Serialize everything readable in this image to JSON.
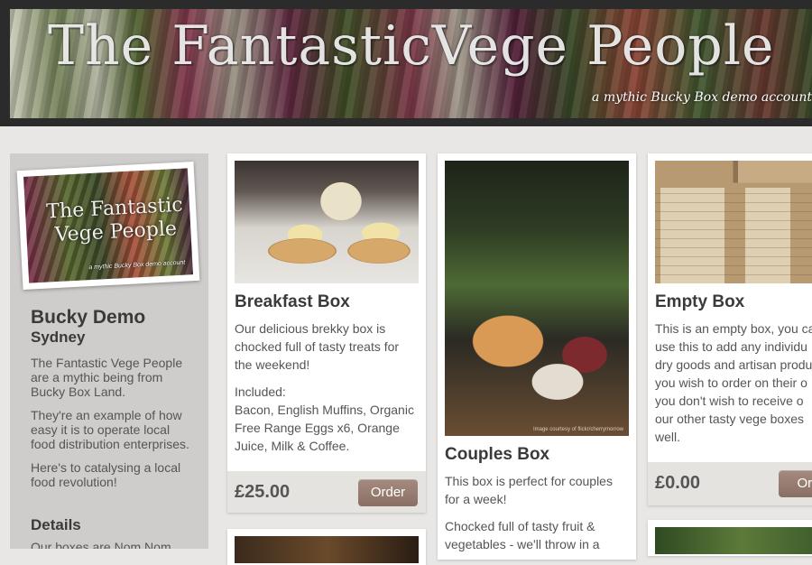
{
  "header": {
    "title": "The FantasticVege People",
    "subtitle": "a mythic Bucky Box demo account"
  },
  "sidebar": {
    "logo_title": "The Fantastic Vege People",
    "logo_subtitle": "a mythic Bucky Box demo account",
    "name": "Bucky Demo",
    "city": "Sydney",
    "paragraphs": [
      "The Fantastic Vege People are a mythic being from Bucky Box Land.",
      "They're an example of how easy it is to operate local food distribution enterprises.",
      "Here's to catalysing a local food revolution!"
    ],
    "details_heading": "Details",
    "details_text": "Our boxes are Nom Nom"
  },
  "products": [
    {
      "title": "Breakfast Box",
      "description": "Our delicious brekky box is chocked full of tasty treats for the weekend!",
      "included_label": "Included:",
      "included_items": "Bacon, English Muffins, Organic Free Range Eggs x6, Orange Juice, Milk & Coffee.",
      "price": "£25.00",
      "order_label": "Order"
    },
    {
      "title": "Couples Box",
      "description": "This box is perfect for couples for a week!",
      "description2": "Chocked full of tasty fruit & vegetables - we'll throw in a",
      "image_credit": "Image courtesy of flickr/cherrymorrow"
    },
    {
      "title": "Empty Box",
      "description": "This is an empty box, you ca use this to add any individu dry goods and artisan produ you wish to order on their o you don't wish to receive o our other tasty vege boxes well.",
      "price": "£0.00",
      "order_label": "Ord"
    }
  ],
  "colors": {
    "page_bg": "#e9e7e5",
    "header_frame": "#2b2b2b",
    "sidebar_bg": "#cfcdcb",
    "order_button": "#9a7f74",
    "card_footer": "#e5e3e0"
  }
}
